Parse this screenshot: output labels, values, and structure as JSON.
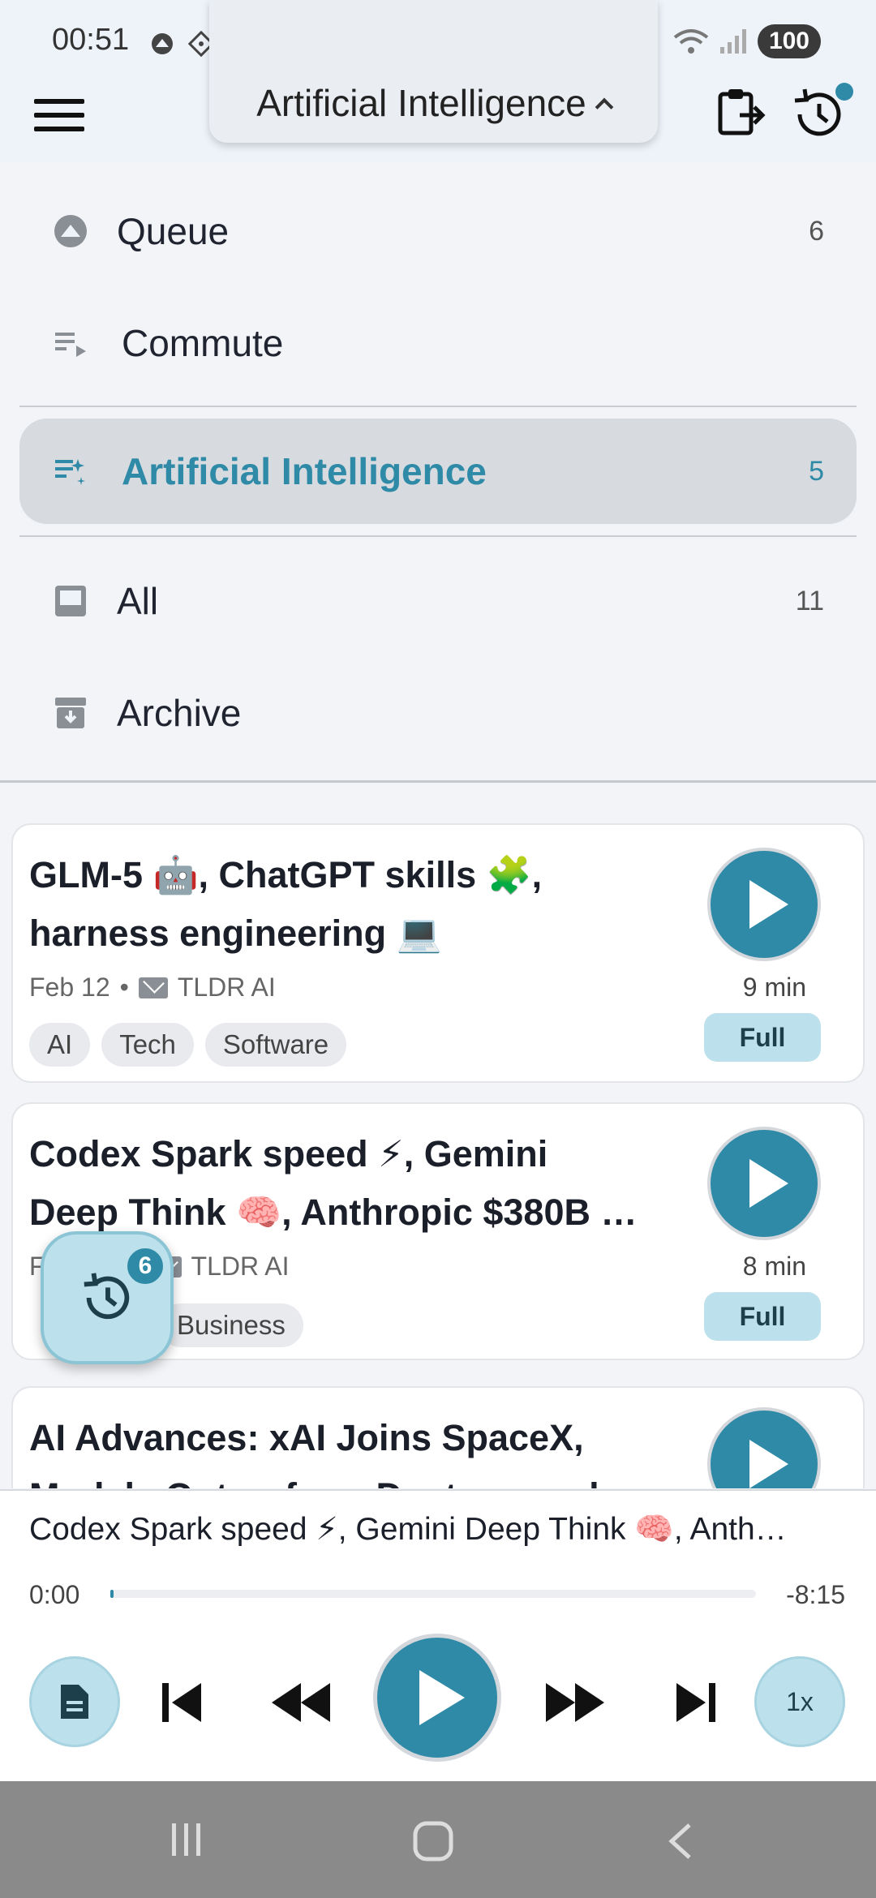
{
  "status_bar": {
    "time": "00:51",
    "battery": "100"
  },
  "header": {
    "title": "Artificial Intelligence"
  },
  "nav": {
    "items": [
      {
        "label": "Queue",
        "count": "6"
      },
      {
        "label": "Commute",
        "count": ""
      },
      {
        "label": "Artificial Intelligence",
        "count": "5"
      },
      {
        "label": "All",
        "count": "11"
      },
      {
        "label": "Archive",
        "count": ""
      }
    ]
  },
  "cards": [
    {
      "title_line1": "GLM-5 🤖, ChatGPT skills 🧩,",
      "title_line2": "harness engineering 💻",
      "date": "Feb 12",
      "source": "TLDR AI",
      "tags": [
        "AI",
        "Tech",
        "Software"
      ],
      "duration": "9 min",
      "mode": "Full"
    },
    {
      "title_line1": "Codex Spark speed ⚡, Gemini",
      "title_line2": "Deep Think 🧠, Anthropic $380B …",
      "date": "F",
      "source": "TLDR AI",
      "tags": [
        "h",
        "Business"
      ],
      "duration": "8 min",
      "mode": "Full"
    },
    {
      "title_line1": "AI Advances: xAI Joins SpaceX,",
      "title_line2": "Models Outperform Doctors, and"
    }
  ],
  "fab": {
    "badge": "6"
  },
  "player": {
    "now_playing": "Codex Spark speed ⚡, Gemini Deep Think 🧠, Anth…",
    "time_elapsed": "0:00",
    "time_remaining": "-8:15",
    "progress": 0.0,
    "speed": "1x"
  }
}
